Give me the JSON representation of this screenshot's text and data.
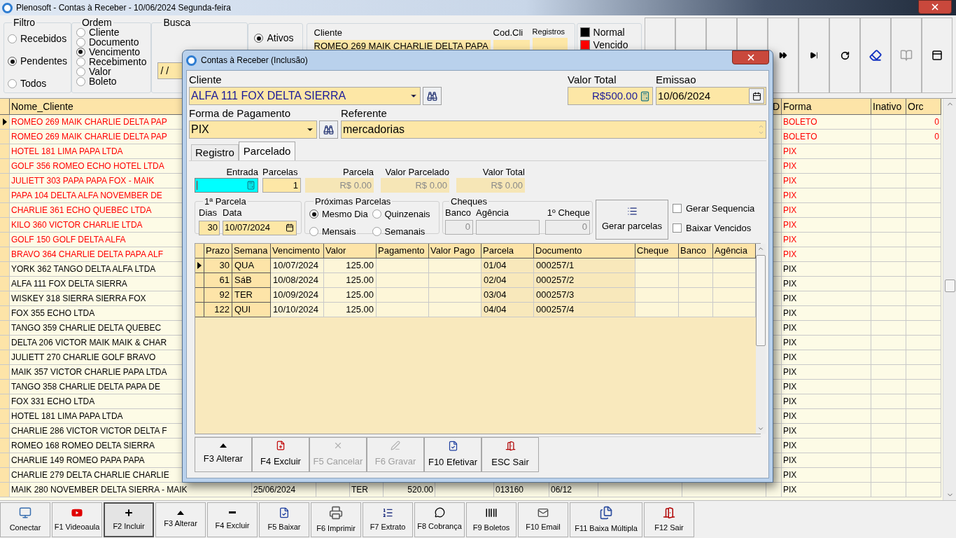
{
  "window": {
    "title": "Plenosoft - Contas à Receber - 10/06/2024 Segunda-feira"
  },
  "filtro": {
    "title": "Filtro",
    "options": [
      {
        "label": "Recebidos",
        "selected": false
      },
      {
        "label": "Pendentes",
        "selected": true
      },
      {
        "label": "Todos",
        "selected": false
      }
    ]
  },
  "ordem": {
    "title": "Ordem",
    "options": [
      {
        "label": "Cliente",
        "selected": false
      },
      {
        "label": "Documento",
        "selected": false
      },
      {
        "label": "Vencimento",
        "selected": true
      },
      {
        "label": "Recebimento",
        "selected": false
      },
      {
        "label": "Valor",
        "selected": false
      },
      {
        "label": "Boleto",
        "selected": false
      }
    ]
  },
  "busca": {
    "title": "Busca",
    "value": "/ /"
  },
  "situacao": {
    "options": [
      {
        "label": "Ativos",
        "selected": true
      }
    ]
  },
  "cliente_panel": {
    "cliente_label": "Cliente",
    "cliente_value": "ROMEO 269 MAIK CHARLIE DELTA PAPA",
    "cod_label": "Cod.Cli",
    "registros_label": "Registros"
  },
  "legend": [
    {
      "label": "Normal",
      "color": "#000000"
    },
    {
      "label": "Vencido",
      "color": "#ff0000"
    }
  ],
  "toolbar": [
    {
      "kind": "blank"
    },
    {
      "kind": "blank"
    },
    {
      "kind": "blank"
    },
    {
      "kind": "blank"
    },
    {
      "kind": "next"
    },
    {
      "kind": "last"
    },
    {
      "kind": "refresh"
    },
    {
      "kind": "eraser"
    },
    {
      "kind": "goto"
    },
    {
      "kind": "form"
    }
  ],
  "grid": {
    "columns": [
      {
        "label": "Nome_Cliente"
      },
      {
        "label": "D"
      },
      {
        "label": "Forma"
      },
      {
        "label": "Inativo"
      },
      {
        "label": "Orc"
      }
    ],
    "rows": [
      {
        "name": "ROMEO 269 MAIK CHARLIE DELTA PAP",
        "overdue": true,
        "selected": true,
        "forma": "BOLETO",
        "orc": "0"
      },
      {
        "name": "ROMEO 269 MAIK CHARLIE DELTA PAP",
        "overdue": true,
        "selected": false,
        "forma": "BOLETO",
        "orc": "0"
      },
      {
        "name": "HOTEL 181 LIMA PAPA LTDA",
        "overdue": true,
        "selected": false,
        "forma": "PIX"
      },
      {
        "name": "GOLF 356 ROMEO ECHO HOTEL LTDA",
        "overdue": true,
        "selected": false,
        "forma": "PIX"
      },
      {
        "name": "JULIETT 303 PAPA PAPA FOX - MAIK",
        "overdue": true,
        "selected": false,
        "forma": "PIX"
      },
      {
        "name": "PAPA 104 DELTA ALFA NOVEMBER DE",
        "overdue": true,
        "selected": false,
        "forma": "PIX"
      },
      {
        "name": "CHARLIE 361 ECHO QUEBEC LTDA",
        "overdue": true,
        "selected": false,
        "forma": "PIX"
      },
      {
        "name": "KILO 360 VICTOR CHARLIE LTDA",
        "overdue": true,
        "selected": false,
        "forma": "PIX"
      },
      {
        "name": "GOLF 150 GOLF DELTA ALFA",
        "overdue": true,
        "selected": false,
        "forma": "PIX"
      },
      {
        "name": "BRAVO 364 CHARLIE DELTA PAPA ALF",
        "overdue": true,
        "selected": false,
        "forma": "PIX"
      },
      {
        "name": "YORK 362 TANGO DELTA ALFA LTDA",
        "overdue": false,
        "selected": false,
        "forma": "PIX"
      },
      {
        "name": "ALFA 111 FOX DELTA SIERRA",
        "overdue": false,
        "selected": false,
        "forma": "PIX"
      },
      {
        "name": "WISKEY 318 SIERRA SIERRA FOX",
        "overdue": false,
        "selected": false,
        "forma": "PIX"
      },
      {
        "name": "FOX 355 ECHO LTDA",
        "overdue": false,
        "selected": false,
        "forma": "PIX"
      },
      {
        "name": "TANGO 359 CHARLIE DELTA QUEBEC",
        "overdue": false,
        "selected": false,
        "forma": "PIX"
      },
      {
        "name": "DELTA 206 VICTOR MAIK MAIK & CHAR",
        "overdue": false,
        "selected": false,
        "forma": "PIX"
      },
      {
        "name": "JULIETT 270 CHARLIE GOLF BRAVO",
        "overdue": false,
        "selected": false,
        "forma": "PIX"
      },
      {
        "name": "MAIK 357 VICTOR CHARLIE PAPA LTDA",
        "overdue": false,
        "selected": false,
        "forma": "PIX"
      },
      {
        "name": "TANGO 358 CHARLIE DELTA PAPA DE",
        "overdue": false,
        "selected": false,
        "forma": "PIX"
      },
      {
        "name": "FOX 331 ECHO LTDA",
        "overdue": false,
        "selected": false,
        "forma": "PIX"
      },
      {
        "name": "HOTEL 181 LIMA PAPA LTDA",
        "overdue": false,
        "selected": false,
        "forma": "PIX"
      },
      {
        "name": "CHARLIE 286 VICTOR VICTOR DELTA F",
        "overdue": false,
        "selected": false,
        "forma": "PIX"
      },
      {
        "name": "ROMEO 168 ROMEO DELTA SIERRA",
        "overdue": false,
        "selected": false,
        "forma": "PIX"
      },
      {
        "name": "CHARLIE 149 ROMEO PAPA PAPA",
        "overdue": false,
        "selected": false,
        "forma": "PIX"
      },
      {
        "name": "CHARLIE 279 DELTA CHARLIE CHARLIE",
        "overdue": false,
        "selected": false,
        "forma": "PIX"
      },
      {
        "name": "MAIK 280 NOVEMBER DELTA SIERRA - MAIK",
        "overdue": false,
        "selected": false,
        "column_2": "25/06/2024",
        "column_4": "TER",
        "column_5": "520.00",
        "column_7": "013160",
        "column_8": "06/12",
        "forma": "PIX"
      }
    ]
  },
  "dialog": {
    "title": "Contas à Receber (Inclusão)",
    "cliente": {
      "label": "Cliente",
      "value": "ALFA 111 FOX DELTA SIERRA"
    },
    "valor_total": {
      "label": "Valor Total",
      "value": "R$500.00"
    },
    "emissao": {
      "label": "Emissao",
      "value": "10/06/2024"
    },
    "forma_pagamento": {
      "label": "Forma de Pagamento",
      "value": "PIX"
    },
    "referente": {
      "label": "Referente",
      "value": "mercadorias"
    },
    "tabs": [
      {
        "label": "Registro",
        "selected": false
      },
      {
        "label": "Parcelado",
        "selected": true
      }
    ],
    "entrada": {
      "label": "Entrada"
    },
    "parcelas": {
      "label": "Parcelas",
      "value": "1"
    },
    "parcela": {
      "label": "Parcela",
      "value": "R$ 0.00"
    },
    "valor_parcelado": {
      "label": "Valor Parcelado",
      "value": "R$ 0.00"
    },
    "valor_total_parcelas": {
      "label": "Valor Total",
      "value": "R$ 0.00"
    },
    "primeira_parcela": {
      "title": "1ª Parcela",
      "dias_label": "Dias",
      "dias": "30",
      "data_label": "Data",
      "data": "10/07/2024"
    },
    "proximas_parcelas": {
      "title": "Próximas Parcelas",
      "options": [
        {
          "label": "Mesmo Dia",
          "selected": true
        },
        {
          "label": "Quinzenais",
          "selected": false
        },
        {
          "label": "Mensais",
          "selected": false
        },
        {
          "label": "Semanais",
          "selected": false
        }
      ]
    },
    "cheques": {
      "title": "Cheques",
      "banco_label": "Banco",
      "banco": "0",
      "agencia_label": "Agência",
      "cheque_label": "1º Cheque",
      "cheque": "0"
    },
    "gerar_button": "Gerar parcelas",
    "checkboxes": [
      {
        "label": "Gerar Sequencia",
        "checked": false
      },
      {
        "label": "Baixar Vencidos",
        "checked": false
      }
    ],
    "table": {
      "columns": [
        {
          "label": "Prazo"
        },
        {
          "label": "Semana"
        },
        {
          "label": "Vencimento"
        },
        {
          "label": "Valor"
        },
        {
          "label": "Pagamento"
        },
        {
          "label": "Valor Pago"
        },
        {
          "label": "Parcela"
        },
        {
          "label": "Documento"
        },
        {
          "label": "Cheque"
        },
        {
          "label": "Banco"
        },
        {
          "label": "Agência"
        }
      ],
      "rows": [
        {
          "prazo": "30",
          "semana": "QUA",
          "vencimento": "10/07/2024",
          "valor": "125.00",
          "parcela": "01/04",
          "documento": "000257/1",
          "selected": true
        },
        {
          "prazo": "61",
          "semana": "SáB",
          "vencimento": "10/08/2024",
          "valor": "125.00",
          "parcela": "02/04",
          "documento": "000257/2",
          "selected": false
        },
        {
          "prazo": "92",
          "semana": "TER",
          "vencimento": "10/09/2024",
          "valor": "125.00",
          "parcela": "03/04",
          "documento": "000257/3",
          "selected": false
        },
        {
          "prazo": "122",
          "semana": "QUI",
          "vencimento": "10/10/2024",
          "valor": "125.00",
          "parcela": "04/04",
          "documento": "000257/4",
          "selected": false
        }
      ]
    },
    "buttons": [
      {
        "label": "F3 Alterar",
        "kind": "edit",
        "disabled": false
      },
      {
        "label": "F4 Excluir",
        "kind": "delete",
        "disabled": false
      },
      {
        "label": "F5 Cancelar",
        "kind": "cancel",
        "disabled": true
      },
      {
        "label": "F6 Gravar",
        "kind": "save",
        "disabled": true
      },
      {
        "label": "F10 Efetivar",
        "kind": "confirm",
        "disabled": false
      },
      {
        "label": "ESC Sair",
        "kind": "exit",
        "disabled": false
      }
    ]
  },
  "bottom_toolbar": [
    {
      "label": "Conectar",
      "kind": "connect",
      "selected": false
    },
    {
      "label": "F1 Videoaula",
      "kind": "video",
      "selected": false
    },
    {
      "label": "F2 Incluir",
      "kind": "add",
      "selected": true
    },
    {
      "label": "F3 Alterar",
      "kind": "edit",
      "selected": false
    },
    {
      "label": "F4 Excluir",
      "kind": "remove",
      "selected": false
    },
    {
      "label": "F5 Baixar",
      "kind": "settle",
      "selected": false
    },
    {
      "label": "F6 Imprimir",
      "kind": "print",
      "selected": false
    },
    {
      "label": "F7 Extrato",
      "kind": "statement",
      "selected": false
    },
    {
      "label": "F8 Cobrança",
      "kind": "message",
      "selected": false
    },
    {
      "label": "F9 Boletos",
      "kind": "barcode",
      "selected": false
    },
    {
      "label": "F10 Email",
      "kind": "email",
      "selected": false
    },
    {
      "label": "F11 Baixa Múltipla",
      "kind": "multi",
      "selected": false
    },
    {
      "label": "F12 Sair",
      "kind": "exit",
      "selected": false
    }
  ]
}
